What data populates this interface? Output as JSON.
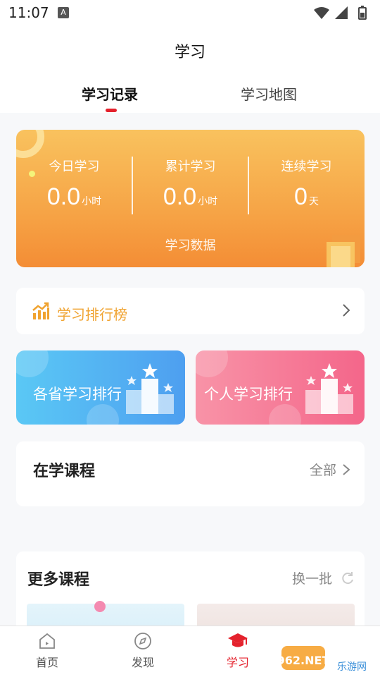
{
  "status_bar": {
    "time": "11:07",
    "notification_glyph": "A"
  },
  "header": {
    "title": "学习",
    "tabs": [
      {
        "label": "学习记录",
        "active": true
      },
      {
        "label": "学习地图",
        "active": false
      }
    ]
  },
  "stats": {
    "items": [
      {
        "label": "今日学习",
        "value": "0.0",
        "unit": "小时"
      },
      {
        "label": "累计学习",
        "value": "0.0",
        "unit": "小时"
      },
      {
        "label": "连续学习",
        "value": "0",
        "unit": "天"
      }
    ],
    "footer": "学习数据"
  },
  "ranking": {
    "label": "学习排行榜",
    "icon": "chart-growth-icon"
  },
  "rank_cards": [
    {
      "label": "各省学习排行",
      "color": "#4e9ff0"
    },
    {
      "label": "个人学习排行",
      "color": "#f4668a"
    }
  ],
  "courses": {
    "title": "在学课程",
    "view_all": "全部"
  },
  "more_courses": {
    "title": "更多课程",
    "refresh": "换一批"
  },
  "bottom_nav": [
    {
      "label": "首页",
      "icon": "home-icon",
      "active": false
    },
    {
      "label": "发现",
      "icon": "compass-icon",
      "active": false
    },
    {
      "label": "学习",
      "icon": "graduation-cap-icon",
      "active": true
    }
  ],
  "colors": {
    "accent": "#e4222d",
    "orange": "#f6a446",
    "gold": "#f0a330"
  },
  "watermark": {
    "brand": "962.NET",
    "sub": "乐游网"
  }
}
